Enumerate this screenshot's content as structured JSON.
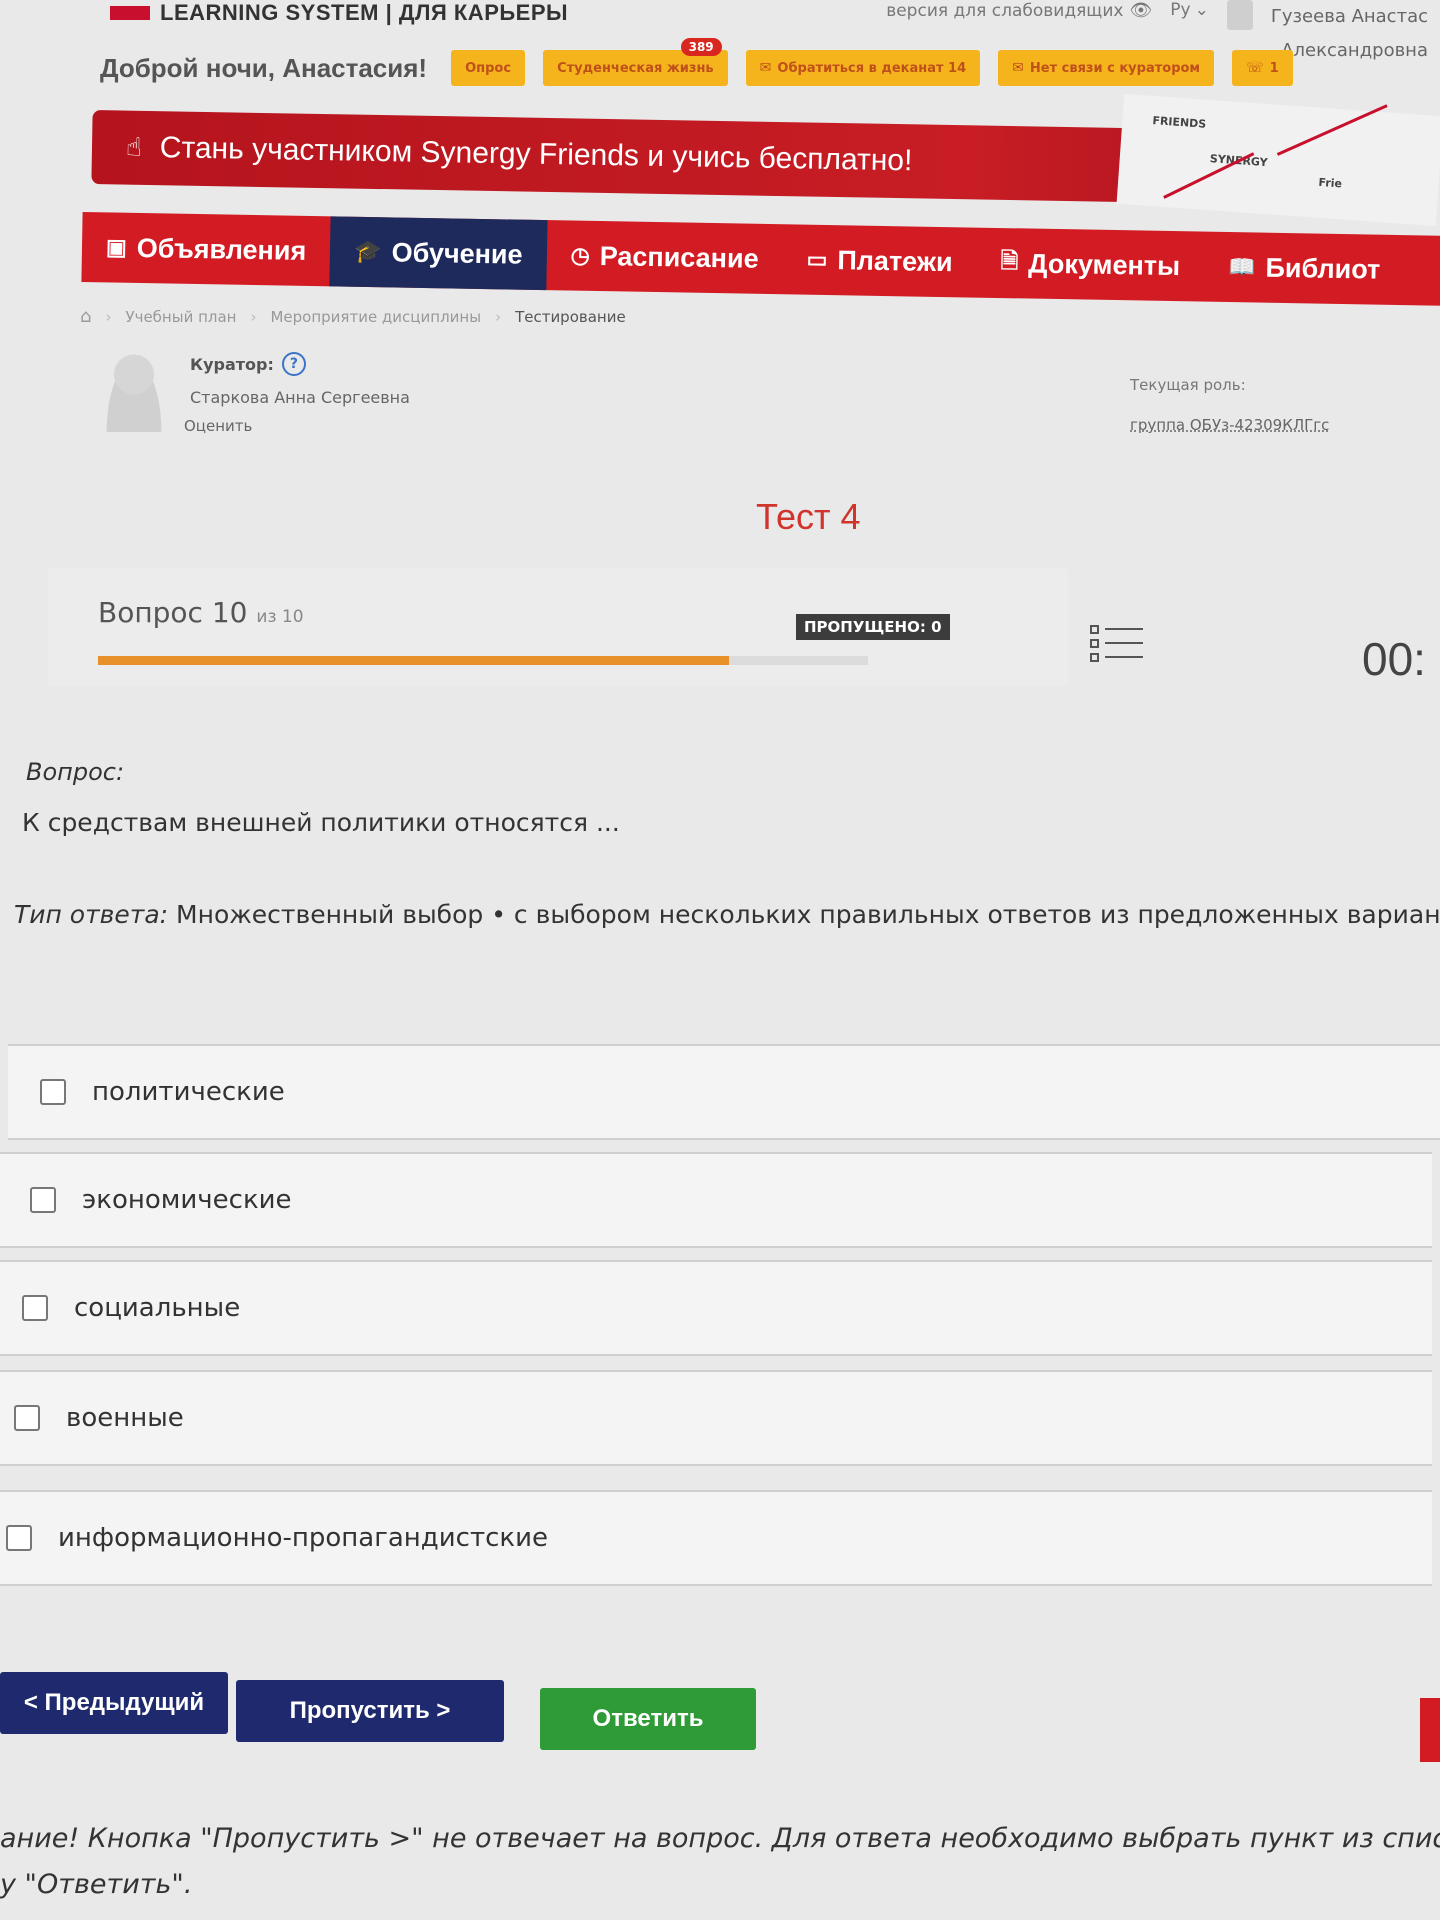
{
  "header": {
    "logo_text": "LEARNING SYSTEM | ДЛЯ КАРЬЕРЫ",
    "vision_link": "версия для слабовидящих",
    "language": "Ру",
    "user_name_line1": "Гузеева Анастас",
    "user_name_line2": "Александровна"
  },
  "greeting": {
    "text": "Доброй ночи, Анастасия!",
    "pills": [
      {
        "label": "Опрос"
      },
      {
        "label": "Студенческая жизнь",
        "badge": "389"
      },
      {
        "label": "Обратиться в деканат 14"
      },
      {
        "label": "Нет связи с куратором"
      },
      {
        "label": "1"
      }
    ]
  },
  "banner": {
    "text": "Стань участником Synergy Friends и учись бесплатно!",
    "art_label_1": "FRIENDS",
    "art_label_2": "SYNERGY",
    "art_label_3": "Frie"
  },
  "nav": {
    "items": [
      {
        "label": "Объявления"
      },
      {
        "label": "Обучение"
      },
      {
        "label": "Расписание"
      },
      {
        "label": "Платежи"
      },
      {
        "label": "Документы"
      },
      {
        "label": "Библиот"
      }
    ]
  },
  "breadcrumb": {
    "items": [
      "Учебный план",
      "Мероприятие дисциплины",
      "Тестирование"
    ]
  },
  "curator": {
    "label": "Куратор:",
    "name": "Старкова Анна Сергеевна",
    "rate_link": "Оценить"
  },
  "role": {
    "label": "Текущая роль:",
    "group": "группа ОБУз-42309КЛГгс"
  },
  "test": {
    "title": "Тест 4",
    "question_label": "Вопрос",
    "current_question": "10",
    "of_label": "из 10",
    "skipped_badge": "ПРОПУЩЕНО: 0",
    "progress_fraction": 0.82,
    "timer": "00:"
  },
  "question": {
    "label": "Вопрос:",
    "text": "К средствам внешней политики относятся ...",
    "answer_type_label": "Тип ответа:",
    "answer_type_value": "Множественный выбор • с выбором нескольких правильных ответов из предложенных вариантов"
  },
  "options": [
    {
      "label": "политические",
      "checked": false
    },
    {
      "label": "экономические",
      "checked": false
    },
    {
      "label": "социальные",
      "checked": false
    },
    {
      "label": "военные",
      "checked": false
    },
    {
      "label": "информационно-пропагандистские",
      "checked": false
    }
  ],
  "buttons": {
    "prev": "< Предыдущий",
    "skip": "Пропустить >",
    "answer": "Ответить"
  },
  "warning": {
    "line1": "ание! Кнопка \"Пропустить >\" не отвечает на вопрос. Для ответа необходимо выбрать пункт из списк",
    "line2": "у \"Ответить\"."
  },
  "colors": {
    "brand_red": "#d31b23",
    "nav_active": "#1f2a5c",
    "progress_orange": "#e8902a",
    "answer_green": "#2e9b36",
    "test_title_red": "#d0342c"
  }
}
